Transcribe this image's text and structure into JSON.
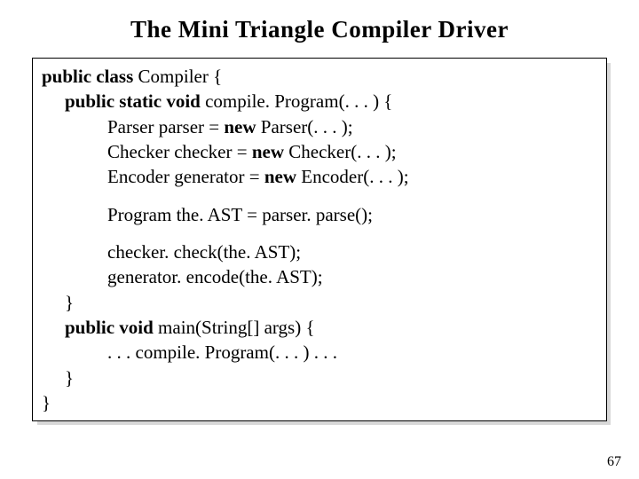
{
  "title": "The Mini Triangle Compiler Driver",
  "page_number": "67",
  "kw": {
    "public_class": "public class ",
    "public_static_void": "public static void ",
    "public_void": "public void ",
    "new": "new "
  },
  "code": {
    "l1_after": "Compiler {",
    "l2_after": "compile. Program(. . . ) {",
    "l3a": "Parser parser = ",
    "l3b": "Parser(. . . );",
    "l4a": "Checker checker = ",
    "l4b": "Checker(. . . );",
    "l5a": "Encoder generator = ",
    "l5b": "Encoder(. . . );",
    "l7": "Program the. AST = parser. parse();",
    "l9": "checker. check(the. AST);",
    "l10": "generator. encode(the. AST);",
    "l11": "}",
    "l12_after": "main(String[] args) {",
    "l13": ". . . compile. Program(. . . ) . . .",
    "l14": "}",
    "l15": "}"
  }
}
